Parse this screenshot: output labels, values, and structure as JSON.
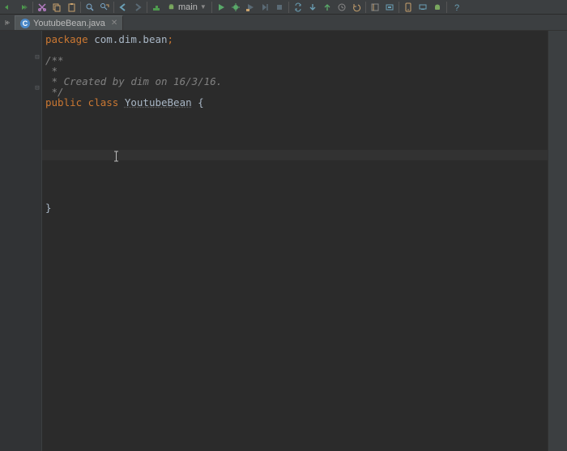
{
  "toolbar": {
    "run_config": "main"
  },
  "tab": {
    "file_icon": "C",
    "filename": "YoutubeBean.java"
  },
  "code": {
    "kw_package": "package",
    "package_name": " com.dim.bean",
    "semicolon": ";",
    "doc_open": "/**",
    "doc_star": " *",
    "doc_line": " * Created by dim on 16/3/16.",
    "doc_close": " */",
    "kw_public": "public",
    "kw_class": " class ",
    "class_name": "YoutubeBean",
    "open_brace": " {",
    "close_brace": "}"
  }
}
